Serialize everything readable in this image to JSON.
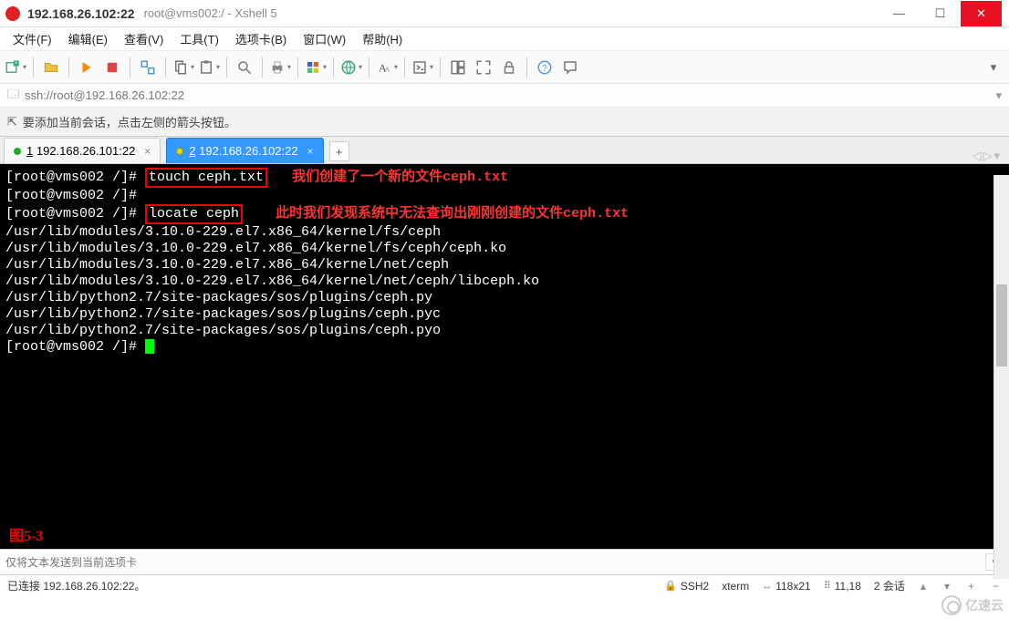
{
  "window": {
    "title_main": "192.168.26.102:22",
    "title_sub": "root@vms002:/ - Xshell 5"
  },
  "menu": {
    "file": "文件(F)",
    "edit": "编辑(E)",
    "view": "查看(V)",
    "tools": "工具(T)",
    "tabs": "选项卡(B)",
    "window": "窗口(W)",
    "help": "帮助(H)"
  },
  "address_bar": {
    "url": "ssh://root@192.168.26.102:22"
  },
  "message_bar": {
    "text": "要添加当前会话，点击左侧的箭头按钮。"
  },
  "tabs": {
    "tab1": {
      "num": "1",
      "label": "192.168.26.101:22"
    },
    "tab2": {
      "num": "2",
      "label": "192.168.26.102:22"
    }
  },
  "terminal": {
    "prompt1": "[root@vms002 /]# ",
    "cmd1": "touch ceph.txt",
    "anno1": "我们创建了一个新的文件ceph.txt",
    "prompt2": "[root@vms002 /]#",
    "prompt3": "[root@vms002 /]# ",
    "cmd3": "locate ceph",
    "anno3": "此时我们发现系统中无法查询出刚刚创建的文件ceph.txt",
    "out1": "/usr/lib/modules/3.10.0-229.el7.x86_64/kernel/fs/ceph",
    "out2": "/usr/lib/modules/3.10.0-229.el7.x86_64/kernel/fs/ceph/ceph.ko",
    "out3": "/usr/lib/modules/3.10.0-229.el7.x86_64/kernel/net/ceph",
    "out4": "/usr/lib/modules/3.10.0-229.el7.x86_64/kernel/net/ceph/libceph.ko",
    "out5": "/usr/lib/python2.7/site-packages/sos/plugins/ceph.py",
    "out6": "/usr/lib/python2.7/site-packages/sos/plugins/ceph.pyc",
    "out7": "/usr/lib/python2.7/site-packages/sos/plugins/ceph.pyo",
    "prompt4": "[root@vms002 /]# ",
    "figure_label": "图5-3"
  },
  "send_bar": {
    "placeholder": "仅将文本发送到当前选项卡"
  },
  "status": {
    "conn": "已连接 192.168.26.102:22。",
    "proto": "SSH2",
    "term": "xterm",
    "size": "118x21",
    "cursor": "11,18",
    "sessions": "2 会话"
  },
  "watermark": {
    "text": "亿速云"
  },
  "icons": {
    "minimize": "—",
    "maximize": "☐",
    "close": "✕",
    "arrow": "↪",
    "lock": "🔒",
    "tab_nav_left": "◁",
    "tab_nav_right": "▷",
    "tab_nav_menu": "▾",
    "plus": "+",
    "size_arrows": "↔",
    "cursor_ico": "⋮⋮",
    "up": "▴",
    "down": "▾",
    "add": "+",
    "minus": "−"
  }
}
